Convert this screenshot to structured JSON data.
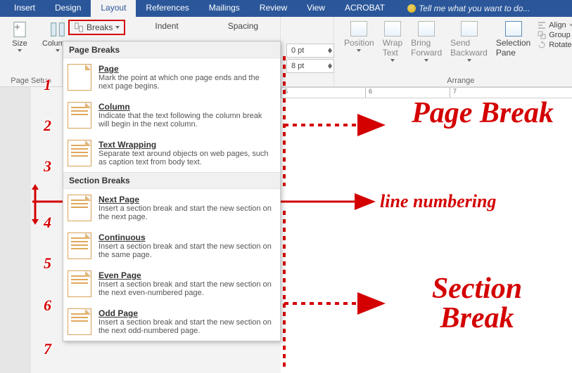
{
  "tabs": {
    "insert": "Insert",
    "design": "Design",
    "layout": "Layout",
    "references": "References",
    "mailings": "Mailings",
    "review": "Review",
    "view": "View",
    "acrobat": "ACROBAT",
    "tellme": "Tell me what you want to do..."
  },
  "ribbon": {
    "size": "Size",
    "columns": "Columns",
    "page_setup": "Page Setup",
    "breaks": "Breaks",
    "indent": "Indent",
    "spacing": "Spacing",
    "before": "0 pt",
    "after": "8 pt",
    "arrange": "Arrange",
    "position": "Position",
    "wrap": "Wrap Text",
    "bring": "Bring Forward",
    "send": "Send Backward",
    "selpane": "Selection Pane",
    "align": "Align",
    "group": "Group",
    "rotate": "Rotate"
  },
  "ruler": {
    "t5": "5",
    "t6": "6",
    "t7": "7"
  },
  "dropdown": {
    "section1": "Page Breaks",
    "page": {
      "title": "Page",
      "desc": "Mark the point at which one page ends and the next page begins."
    },
    "column": {
      "title": "Column",
      "desc": "Indicate that the text following the column break will begin in the next column."
    },
    "wrap": {
      "title": "Text Wrapping",
      "desc": "Separate text around objects on web pages, such as caption text from body text."
    },
    "section2": "Section Breaks",
    "next": {
      "title": "Next Page",
      "desc": "Insert a section break and start the new section on the next page."
    },
    "cont": {
      "title": "Continuous",
      "desc": "Insert a section break and start the new section on the same page."
    },
    "even": {
      "title": "Even Page",
      "desc": "Insert a section break and start the new section on the next even-numbered page."
    },
    "odd": {
      "title": "Odd Page",
      "desc": "Insert a section break and start the new section on the next odd-numbered page."
    }
  },
  "ann": {
    "n1": "1",
    "n2": "2",
    "n3": "3",
    "n4": "4",
    "n5": "5",
    "n6": "6",
    "n7": "7",
    "page_break": "Page Break",
    "section_break": "Section Break",
    "line_num": "line numbering"
  }
}
